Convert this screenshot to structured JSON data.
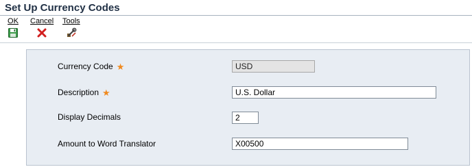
{
  "window": {
    "title": "Set Up Currency Codes"
  },
  "toolbar": {
    "ok_label": "OK",
    "cancel_label": "Cancel",
    "tools_label": "Tools"
  },
  "form": {
    "currency_code": {
      "label": "Currency Code",
      "value": "USD",
      "required_mark": "★"
    },
    "description": {
      "label": "Description",
      "value": "U.S. Dollar",
      "required_mark": "★"
    },
    "display_decimals": {
      "label": "Display Decimals",
      "value": "2"
    },
    "amount_to_word": {
      "label": "Amount to Word Translator",
      "value": "X00500"
    }
  },
  "colors": {
    "title": "#1f2f44",
    "panel_background": "#e8edf3",
    "required_star": "#f08a1f",
    "cancel_icon": "#d21f1f",
    "ok_icon": "#3a9a48"
  },
  "icons": {
    "ok": "save-disk-icon",
    "cancel": "red-x-icon",
    "tools": "tools-wrench-icon"
  }
}
